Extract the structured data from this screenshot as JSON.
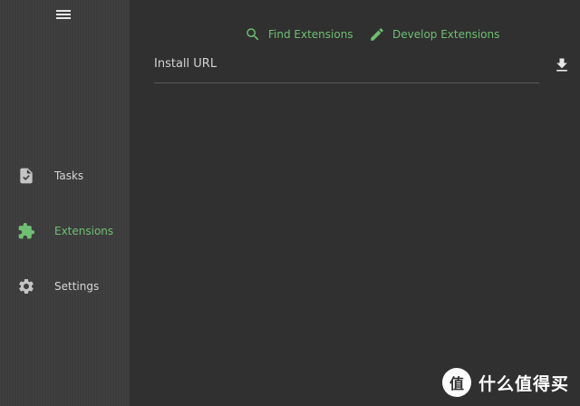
{
  "sidebar": {
    "menu_icon": "hamburger-menu-icon",
    "items": [
      {
        "id": "tasks",
        "label": "Tasks",
        "icon": "task-file-check-icon",
        "active": false
      },
      {
        "id": "extensions",
        "label": "Extensions",
        "icon": "puzzle-piece-icon",
        "active": true
      },
      {
        "id": "settings",
        "label": "Settings",
        "icon": "gear-icon",
        "active": false
      }
    ]
  },
  "main": {
    "links": [
      {
        "label": "Find Extensions",
        "icon": "search-icon"
      },
      {
        "label": "Develop Extensions",
        "icon": "pencil-icon"
      }
    ],
    "install": {
      "label": "Install URL",
      "value": "",
      "download_icon": "download-icon"
    }
  },
  "watermark": {
    "logo_text": "值",
    "text": "什么值得买"
  },
  "colors": {
    "accent": "#6fbf73",
    "sidebar_bg": "#3c3c3c",
    "main_bg": "#303030",
    "text": "#d6d6d6"
  }
}
